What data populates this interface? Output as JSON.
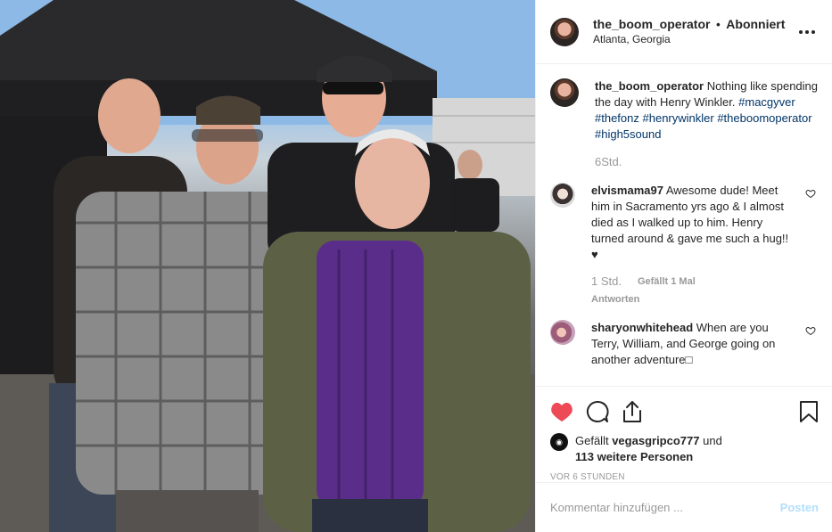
{
  "post": {
    "image_alt_icon": "photo",
    "owner": {
      "username": "the_boom_operator",
      "separator": "•",
      "follow_status": "Abonniert",
      "location": "Atlanta, Georgia"
    },
    "caption": {
      "username": "the_boom_operator",
      "text": "Nothing like spending the day with Henry Winkler.",
      "hashtags": [
        "#macgyver",
        "#thefonz",
        "#henrywinkler",
        "#theboomoperator",
        "#high5sound"
      ],
      "time": "6Std."
    },
    "comments": [
      {
        "username": "elvismama97",
        "text": "Awesome dude! Meet him in Sacramento yrs ago & I almost died as I walked up to him. Henry turned around & gave me such a hug!! ♥",
        "time": "1 Std.",
        "likes": "Gefällt 1 Mal",
        "reply": "Antworten"
      },
      {
        "username": "sharyonwhitehead",
        "text": "When are you Terry, William, and George going on another adventure□"
      }
    ],
    "likes": {
      "liker": "vegasgripco777",
      "connector": "und",
      "count_text": "113 weitere Personen",
      "prefix": "Gefällt"
    },
    "timestamp": "VOR 6 STUNDEN",
    "add_comment": {
      "placeholder": "Kommentar hinzufügen ...",
      "post_label": "Posten"
    },
    "colors": {
      "like_red": "#ed4956",
      "hashtag_blue": "#003569",
      "muted": "#999999",
      "post_disabled": "#b2dffc"
    }
  }
}
